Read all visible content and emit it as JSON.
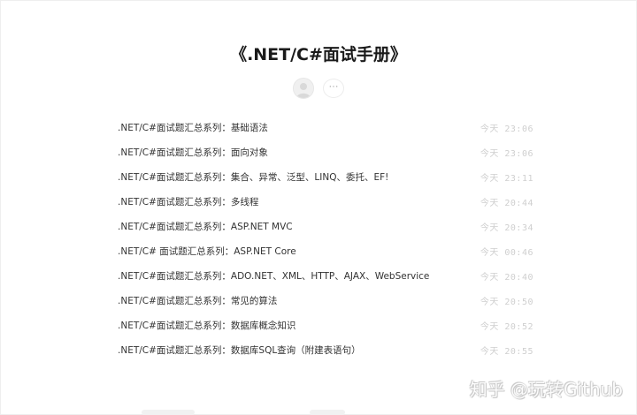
{
  "column": {
    "title": "《.NET/C#面试手册》",
    "more_label": "···"
  },
  "articles": [
    {
      "title": ".NET/C#面试题汇总系列：基础语法",
      "time": "今天 23:06"
    },
    {
      "title": ".NET/C#面试题汇总系列：面向对象",
      "time": "今天 23:06"
    },
    {
      "title": ".NET/C#面试题汇总系列：集合、异常、泛型、LINQ、委托、EF!",
      "time": "今天 23:11"
    },
    {
      "title": ".NET/C#面试题汇总系列：多线程",
      "time": "今天 20:44"
    },
    {
      "title": ".NET/C#面试题汇总系列：ASP.NET MVC",
      "time": "今天 20:34"
    },
    {
      "title": ".NET/C# 面试题汇总系列：ASP.NET Core",
      "time": "今天 00:46"
    },
    {
      "title": ".NET/C#面试题汇总系列：ADO.NET、XML、HTTP、AJAX、WebService",
      "time": "今天 20:40"
    },
    {
      "title": ".NET/C#面试题汇总系列：常见的算法",
      "time": "今天 20:50"
    },
    {
      "title": ".NET/C#面试题汇总系列：数据库概念知识",
      "time": "今天 20:52"
    },
    {
      "title": ".NET/C#面试题汇总系列：数据库SQL查询（附建表语句）",
      "time": "今天 20:55"
    }
  ],
  "watermark": {
    "text": "知乎 @玩转Github"
  }
}
